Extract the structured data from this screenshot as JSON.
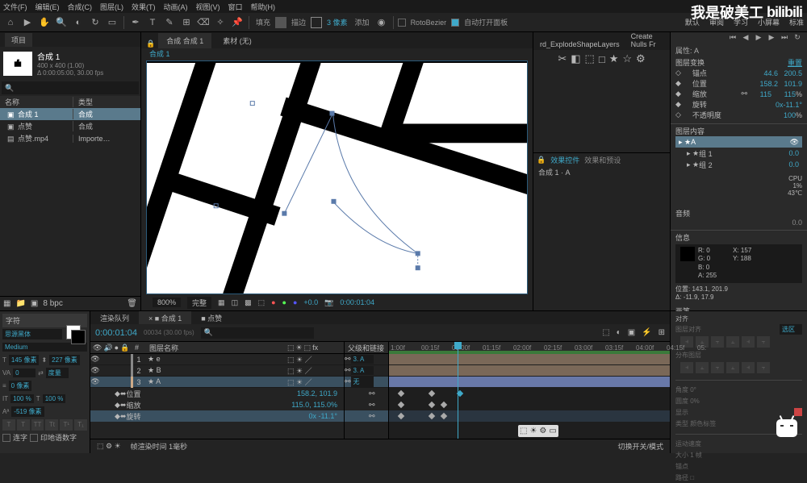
{
  "menu": {
    "items": [
      "文件(F)",
      "编辑(E)",
      "合成(C)",
      "图层(L)",
      "效果(T)",
      "动画(A)",
      "视图(V)",
      "窗口",
      "帮助(H)"
    ]
  },
  "toolbar": {
    "fill_label": "填充",
    "stroke_label": "描边",
    "px_label": "3 像素",
    "add_label": "添加",
    "rotobezier": "RotoBezier",
    "auto_open": "自动打开面板",
    "right": [
      "默认",
      "审阅",
      "学习",
      "小屏幕",
      "标准"
    ],
    "scripts": [
      "rd_ExplodeShapeLayers",
      "Create Nulls Fr"
    ]
  },
  "watermark": "我是破美工",
  "project": {
    "tab": "项目",
    "item_name": "合成 1",
    "item_info1": "400 x 400 (1.00)",
    "item_info2": "Δ 0:00:05:00, 30.00 fps",
    "col_name": "名称",
    "col_type": "类型",
    "rows": [
      {
        "name": "合成 1",
        "type": "合成",
        "sel": true,
        "icon": "▣"
      },
      {
        "name": "点赞",
        "type": "合成",
        "sel": false,
        "icon": "▣"
      },
      {
        "name": "点赞.mp4",
        "type": "Importe…",
        "sel": false,
        "icon": "▤"
      }
    ],
    "bpc": "8 bpc"
  },
  "viewer": {
    "tab1": "合成 合成 1",
    "tab2": "素材 (无)",
    "sub": "合成 1",
    "zoom": "800%",
    "quality": "完整",
    "exposure": "+0.0",
    "time": "0:00:01:04"
  },
  "mid": {
    "tab": "效果控件",
    "tab2": "效果和预设",
    "layer": "合成 1 · A"
  },
  "props": {
    "title": "属性: A",
    "section": "图层变换",
    "reset": "重置",
    "rows": [
      {
        "label": "锚点",
        "v1": "44.6",
        "v2": "200.5"
      },
      {
        "label": "位置",
        "v1": "158.2",
        "v2": "101.9"
      },
      {
        "label": "缩放",
        "v1": "115",
        "v2": "115",
        "suffix": "%"
      },
      {
        "label": "旋转",
        "v1": "0x",
        "v2": "-11.1°"
      },
      {
        "label": "不透明度",
        "v1": "100",
        "suffix": "%"
      }
    ],
    "content_title": "图层内容",
    "contents": [
      {
        "name": "A",
        "sel": true
      },
      {
        "name": "组 1",
        "sel": false
      },
      {
        "name": "组 2",
        "sel": false
      }
    ],
    "content_vals": [
      "0.0",
      "0.0"
    ],
    "cpu": "CPU",
    "cpu_pct": "1%",
    "temp": "43℃"
  },
  "audio": {
    "title": "音频",
    "level": "0.0"
  },
  "info": {
    "title": "信息",
    "rgb": {
      "r": "R: 0",
      "g": "G: 0",
      "b": "B: 0",
      "a": "A: 255"
    },
    "xy": {
      "x": "X: 157",
      "y": "Y: 188"
    },
    "pos": "位置: 143.1, 201.9",
    "delta": "Δ: -11.9, 17.9"
  },
  "pict": {
    "title": "画笔"
  },
  "anchor": {
    "title": "对齐",
    "layers": "图层对齐",
    "sel": "选区",
    "layers2": "分布图层"
  },
  "char": {
    "tab": "字符",
    "font": "思源黑体",
    "weight": "Medium",
    "size": "145 像素",
    "leading": "227 像素",
    "kerning": "0",
    "tracking": "度量",
    "scale_h": "100 %",
    "scale_v": "100 %",
    "baseline": "-519 像素",
    "stroke": "0 像素",
    "f1": "连字",
    "f2": "印地语数字"
  },
  "timeline": {
    "tabs": [
      "渲染队列",
      "合成 1",
      "点赞"
    ],
    "time": "0:00:01:04",
    "frame": "00034 (30.00 fps)",
    "col_src": "图层名称",
    "col_parent": "父级和链接",
    "ticks": [
      "1:00f",
      "00:15f",
      "01:00f",
      "01:15f",
      "02:00f",
      "02:15f",
      "03:00f",
      "03:15f",
      "04:00f",
      "04:15f",
      "05:"
    ],
    "layers": [
      {
        "num": "1",
        "name": "e",
        "color": "#888",
        "parent": "3. A"
      },
      {
        "num": "2",
        "name": "B",
        "color": "#888",
        "parent": "3. A"
      },
      {
        "num": "3",
        "name": "A",
        "color": "#ca8",
        "parent": "无",
        "sel": true
      }
    ],
    "props": [
      {
        "label": "位置",
        "val": "158.2, 101.9"
      },
      {
        "label": "缩放",
        "val": "115.0, 115.0%"
      },
      {
        "label": "旋转",
        "val": "0x -11.1°"
      }
    ],
    "footer_l": "帧渲染时间 1毫秒",
    "footer_r": "切换开关/模式"
  },
  "tr_panel": {
    "type": "类型",
    "angle": "角度 0°",
    "snap": "圆度 0%",
    "display": "显示",
    "type2": "类型 颜色标签",
    "motion": "运动速度",
    "size": "大小 1 帧",
    "shape": "锚点",
    "path": "路径 □"
  }
}
